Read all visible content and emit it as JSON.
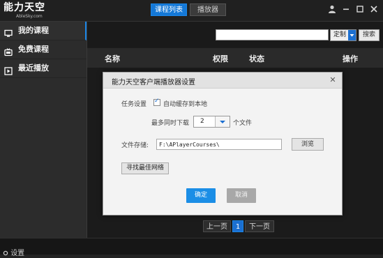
{
  "app": {
    "logo_text": "能力天空",
    "logo_sub": "AbleSky.com"
  },
  "top_tabs": [
    {
      "label": "课程列表",
      "active": true
    },
    {
      "label": "播放器",
      "active": false
    }
  ],
  "window_controls": [
    "user-icon",
    "minimize-icon",
    "maximize-icon",
    "close-icon"
  ],
  "sidebar": {
    "items": [
      {
        "label": "我的课程",
        "icon": "monitor-icon",
        "active": true
      },
      {
        "label": "免费课程",
        "icon": "tv-icon",
        "active": false
      },
      {
        "label": "最近播放",
        "icon": "play-icon",
        "active": false
      }
    ]
  },
  "search": {
    "value": "",
    "select_value": "定制",
    "button_label": "搜索"
  },
  "table": {
    "headers": [
      "名称",
      "权限",
      "状态",
      "操作"
    ]
  },
  "pager": {
    "prev_label": "上一页",
    "current_page": "1",
    "next_label": "下一页"
  },
  "bottom": {
    "settings_label": "设置"
  },
  "dialog": {
    "title": "能力天空客户端播放器设置",
    "task_label": "任务设置",
    "auto_cache_label": "自动缓存到本地",
    "auto_cache_checked": true,
    "max_download_label": "最多同时下载",
    "max_download_value": "2",
    "max_download_unit": "个文件",
    "storage_label": "文件存储:",
    "storage_path": "F:\\APlayerCourses\\",
    "browse_label": "浏览",
    "find_network_label": "寻找最佳网络",
    "ok_label": "确定",
    "cancel_label": "取消"
  },
  "colors": {
    "accent": "#1b86e6",
    "background": "#1b1b1b",
    "sidebar": "#2c2c2c",
    "dialog_bg": "#f3f3f3"
  }
}
